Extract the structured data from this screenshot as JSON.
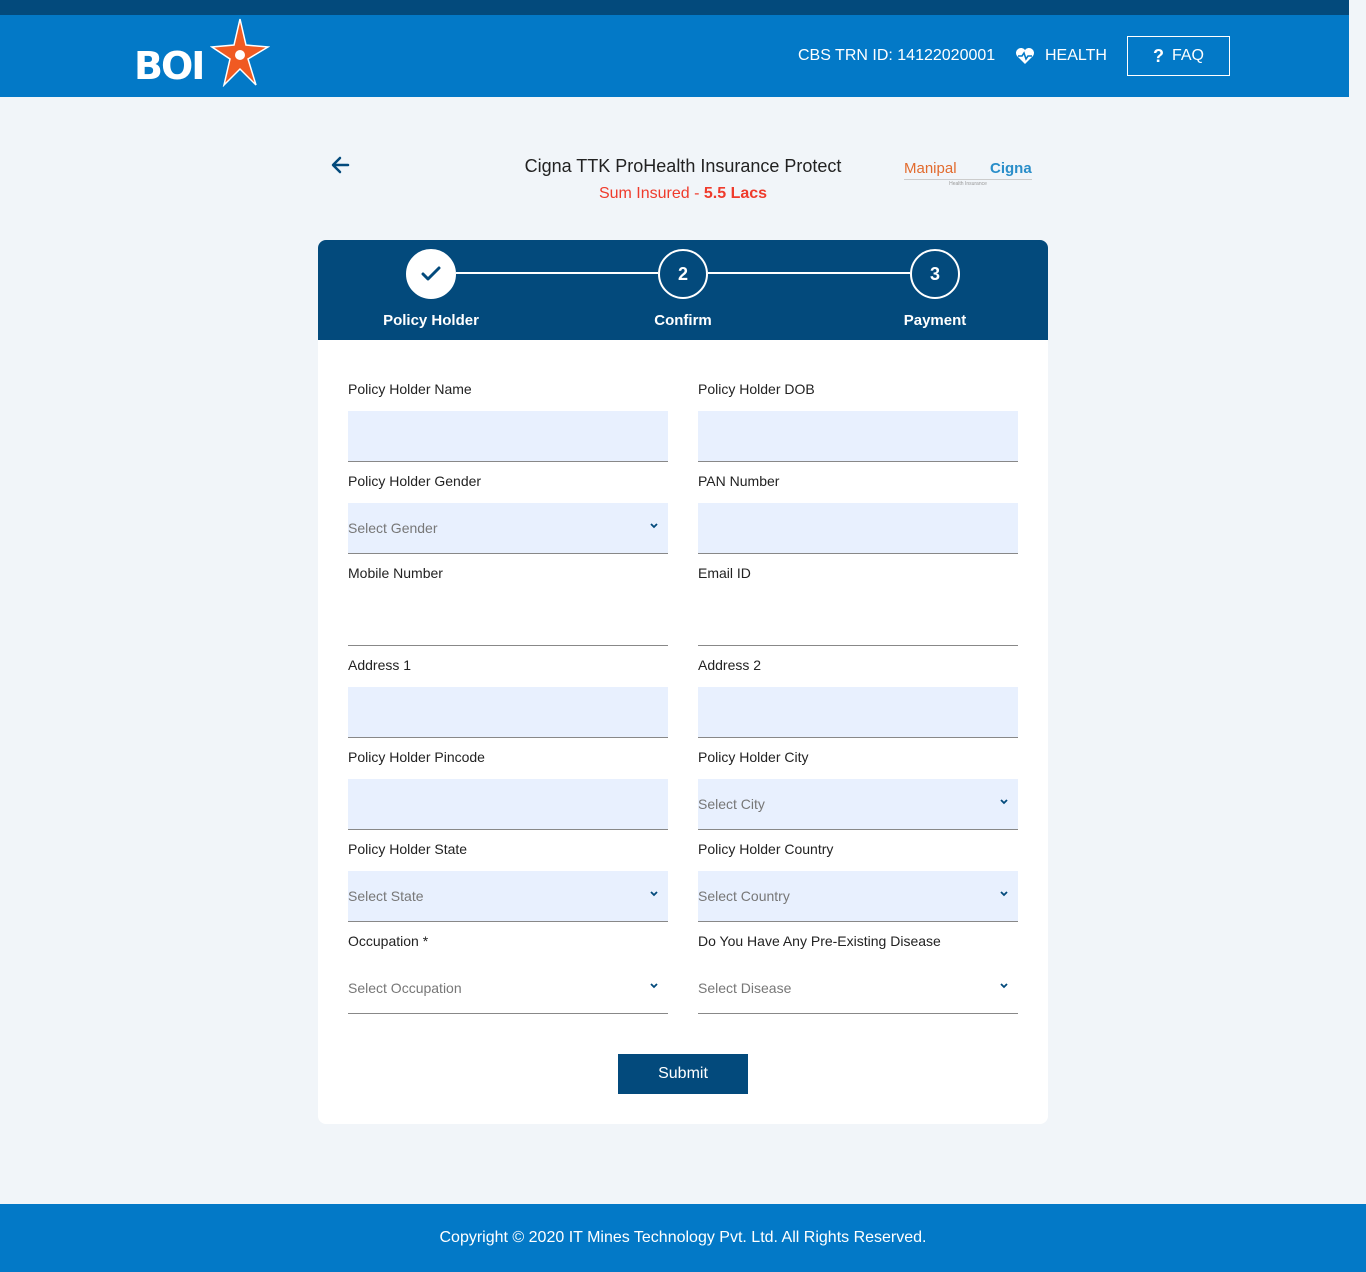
{
  "header": {
    "logo_text": "BOI",
    "trn": "CBS TRN ID: 14122020001",
    "health_label": "HEALTH",
    "faq_label": "FAQ",
    "icons": [
      "back-arrow-icon",
      "heart-pulse-icon",
      "question-icon",
      "check-icon",
      "chevron-down-icon"
    ]
  },
  "product": {
    "title": "Cigna TTK ProHealth Insurance Protect",
    "sum_label": "Sum Insured - ",
    "sum_value": "5.5 Lacs",
    "insurer_name_1": "Manipal",
    "insurer_name_2": "Cigna",
    "insurer_sub": "Health Insurance"
  },
  "steps": [
    {
      "number": "",
      "label": "Policy Holder",
      "status": "done"
    },
    {
      "number": "2",
      "label": "Confirm",
      "status": "pending"
    },
    {
      "number": "3",
      "label": "Payment",
      "status": "pending"
    }
  ],
  "form": {
    "holder_name": {
      "label": "Policy Holder Name",
      "value": ""
    },
    "holder_dob": {
      "label": "Policy Holder DOB",
      "value": ""
    },
    "gender": {
      "label": "Policy Holder Gender",
      "placeholder": "Select Gender"
    },
    "pan": {
      "label": "PAN Number",
      "value": ""
    },
    "mobile": {
      "label": "Mobile Number",
      "value": ""
    },
    "email": {
      "label": "Email ID",
      "value": ""
    },
    "address1": {
      "label": "Address 1",
      "value": ""
    },
    "address2": {
      "label": "Address 2",
      "value": ""
    },
    "pincode": {
      "label": "Policy Holder Pincode",
      "value": ""
    },
    "city": {
      "label": "Policy Holder City",
      "placeholder": "Select City"
    },
    "state": {
      "label": "Policy Holder State",
      "placeholder": "Select State"
    },
    "country": {
      "label": "Policy Holder Country",
      "placeholder": "Select Country"
    },
    "occupation": {
      "label": "Occupation *",
      "placeholder": "Select Occupation"
    },
    "disease": {
      "label": "Do You Have Any Pre-Existing Disease",
      "placeholder": "Select Disease"
    },
    "submit_label": "Submit"
  },
  "footer": {
    "copyright": "Copyright © 2020 IT Mines Technology Pvt. Ltd. All Rights Reserved."
  },
  "colors": {
    "header_blue": "#0379c7",
    "dark_blue": "#034a7c",
    "accent_red": "#ef3b2c",
    "input_fill": "#e8f0fe"
  }
}
